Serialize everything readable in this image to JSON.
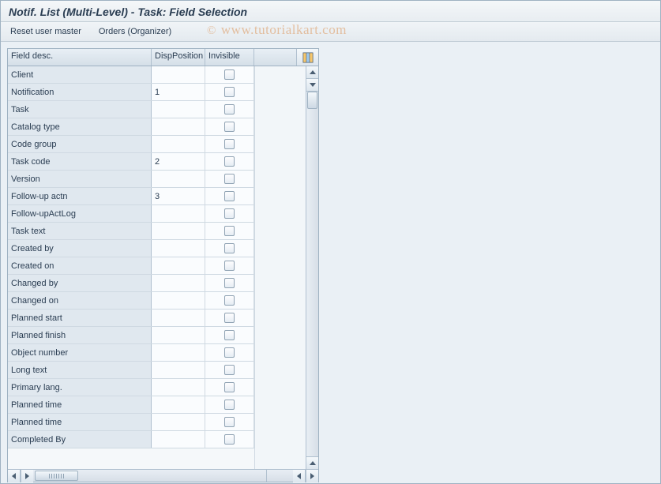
{
  "title": "Notif. List (Multi-Level) - Task: Field Selection",
  "toolbar": {
    "reset": "Reset user master",
    "orders": "Orders (Organizer)"
  },
  "columns": {
    "desc": "Field desc.",
    "pos": "DispPosition",
    "invis": "Invisible"
  },
  "rows": [
    {
      "desc": "Client",
      "pos": "",
      "invis": false
    },
    {
      "desc": "Notification",
      "pos": "1",
      "invis": false
    },
    {
      "desc": "Task",
      "pos": "",
      "invis": false
    },
    {
      "desc": "Catalog type",
      "pos": "",
      "invis": false
    },
    {
      "desc": "Code group",
      "pos": "",
      "invis": false
    },
    {
      "desc": "Task code",
      "pos": "2",
      "invis": false
    },
    {
      "desc": "Version",
      "pos": "",
      "invis": false
    },
    {
      "desc": "Follow-up actn",
      "pos": "3",
      "invis": false
    },
    {
      "desc": "Follow-upActLog",
      "pos": "",
      "invis": false
    },
    {
      "desc": "Task text",
      "pos": "",
      "invis": false
    },
    {
      "desc": "Created by",
      "pos": "",
      "invis": false
    },
    {
      "desc": "Created on",
      "pos": "",
      "invis": false
    },
    {
      "desc": "Changed by",
      "pos": "",
      "invis": false
    },
    {
      "desc": "Changed on",
      "pos": "",
      "invis": false
    },
    {
      "desc": "Planned start",
      "pos": "",
      "invis": false
    },
    {
      "desc": "Planned finish",
      "pos": "",
      "invis": false
    },
    {
      "desc": "Object number",
      "pos": "",
      "invis": false
    },
    {
      "desc": "Long text",
      "pos": "",
      "invis": false
    },
    {
      "desc": "Primary lang.",
      "pos": "",
      "invis": false
    },
    {
      "desc": "Planned time",
      "pos": "",
      "invis": false
    },
    {
      "desc": "Planned time",
      "pos": "",
      "invis": false
    },
    {
      "desc": "Completed By",
      "pos": "",
      "invis": false
    }
  ],
  "watermark": "© www.tutorialkart.com"
}
